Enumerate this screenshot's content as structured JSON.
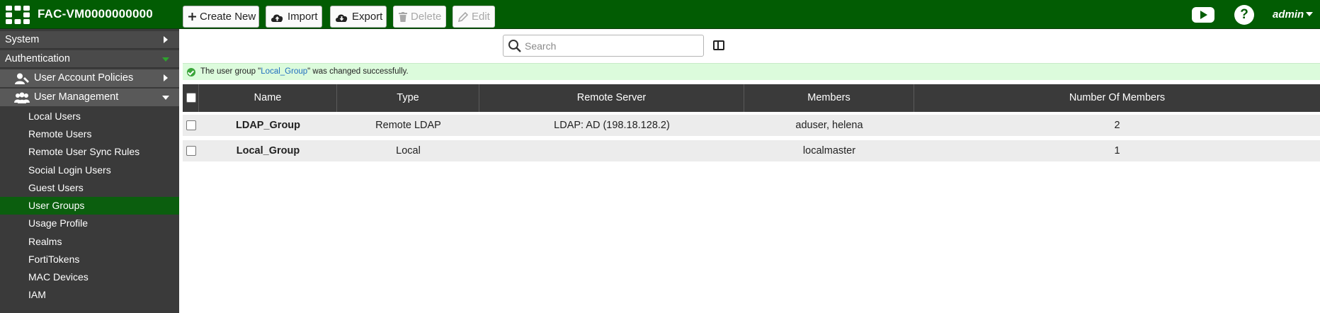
{
  "header": {
    "hostname": "FAC-VM0000000000",
    "help_label": "?",
    "user_label": "admin"
  },
  "sidebar": {
    "items": [
      {
        "label": "System"
      },
      {
        "label": "Authentication"
      },
      {
        "label": "User Account Policies"
      },
      {
        "label": "User Management"
      },
      {
        "label": "Local Users"
      },
      {
        "label": "Remote Users"
      },
      {
        "label": "Remote User Sync Rules"
      },
      {
        "label": "Social Login Users"
      },
      {
        "label": "Guest Users"
      },
      {
        "label": "User Groups"
      },
      {
        "label": "Usage Profile"
      },
      {
        "label": "Realms"
      },
      {
        "label": "FortiTokens"
      },
      {
        "label": "MAC Devices"
      },
      {
        "label": "IAM"
      }
    ],
    "active_item": "User Groups"
  },
  "toolbar": {
    "create_label": "Create New",
    "import_label": "Import",
    "export_label": "Export",
    "delete_label": "Delete",
    "edit_label": "Edit",
    "search_placeholder": "Search"
  },
  "notice": {
    "prefix": "The user group \"",
    "group": "Local_Group",
    "suffix": "\" was changed successfully."
  },
  "table": {
    "columns": [
      "Name",
      "Type",
      "Remote Server",
      "Members",
      "Number Of Members"
    ],
    "rows": [
      {
        "name": "LDAP_Group",
        "type": "Remote LDAP",
        "remote_server": "LDAP: AD (198.18.128.2)",
        "members": "aduser, helena",
        "count": "2"
      },
      {
        "name": "Local_Group",
        "type": "Local",
        "remote_server": "",
        "members": "localmaster",
        "count": "1"
      }
    ]
  },
  "colors": {
    "header_green": "#025c03",
    "active_green": "#0b5e0e",
    "sidebar_dark": "#3a3a3a",
    "success_bg": "#dcfbdc",
    "link_blue": "#1f6dbf"
  }
}
